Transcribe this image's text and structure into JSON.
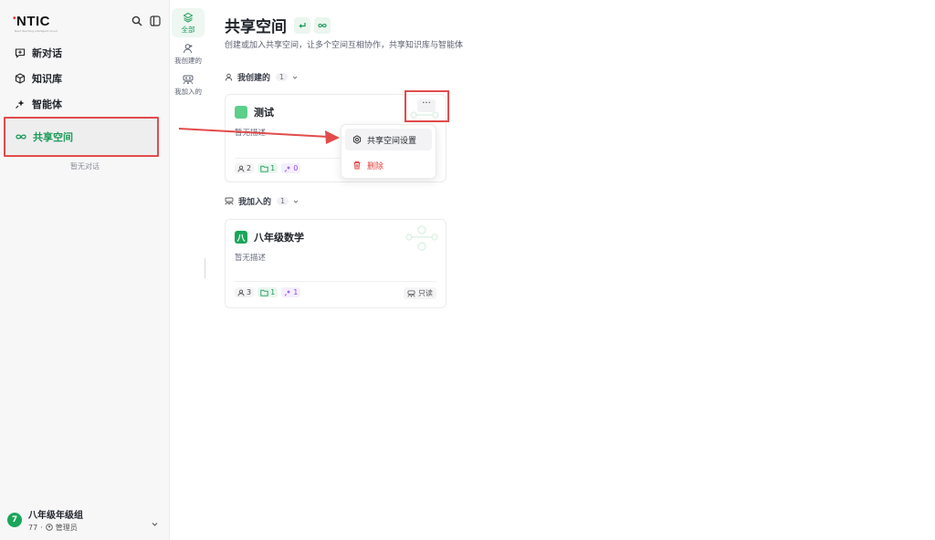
{
  "app": {
    "logo": "NTIC",
    "logo_sub": "Next Teaching Intelligent Cloud"
  },
  "sidebar": {
    "items": [
      {
        "label": "新对话",
        "icon": "chat-plus-icon"
      },
      {
        "label": "知识库",
        "icon": "cube-icon"
      },
      {
        "label": "智能体",
        "icon": "sparkle-icon"
      },
      {
        "label": "共享空间",
        "icon": "infinity-icon",
        "active": true
      }
    ],
    "empty_text": "暂无对话",
    "org": {
      "avatar": "7",
      "name": "八年级年级组",
      "count": "77",
      "role": "管理员"
    }
  },
  "rail": {
    "items": [
      {
        "label": "全部",
        "icon": "layers-icon",
        "active": true
      },
      {
        "label": "我创建的",
        "icon": "user-icon"
      },
      {
        "label": "我加入的",
        "icon": "group-icon"
      }
    ]
  },
  "main": {
    "title": "共享空间",
    "subtitle": "创建或加入共享空间，让多个空间互相协作，共享知识库与智能体",
    "sections": [
      {
        "label": "我创建的",
        "count": "1"
      },
      {
        "label": "我加入的",
        "count": "1"
      }
    ],
    "cards": [
      {
        "badge": "",
        "badge_color": "#5ccf8b",
        "title": "测试",
        "desc": "暂无描述",
        "members": "2",
        "kbs": "1",
        "agents": "0",
        "more": "···"
      },
      {
        "badge": "八",
        "badge_color": "#1aa65a",
        "title": "八年级数学",
        "desc": "暂无描述",
        "members": "3",
        "kbs": "1",
        "agents": "1",
        "readonly": "只读"
      }
    ],
    "menu": {
      "settings": "共享空间设置",
      "delete": "删除"
    }
  },
  "colors": {
    "accent": "#1a9a58",
    "danger": "#e2433f",
    "annotation": "#e24b4b"
  }
}
